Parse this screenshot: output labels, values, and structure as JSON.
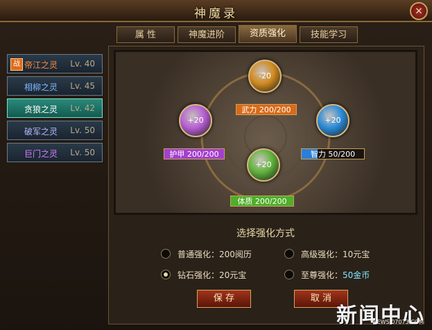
{
  "window": {
    "title": "神魔录",
    "close_glyph": "×"
  },
  "tabs": [
    {
      "label": "属  性"
    },
    {
      "label": "神魔进阶"
    },
    {
      "label": "资质强化"
    },
    {
      "label": "技能学习"
    }
  ],
  "sidebar": {
    "items": [
      {
        "name": "帝江之灵",
        "lv": "Lv. 40",
        "color": "#ff8a3d",
        "badge": "战"
      },
      {
        "name": "相柳之灵",
        "lv": "Lv. 45",
        "color": "#7fb8ff"
      },
      {
        "name": "贪狼之灵",
        "lv": "Lv. 42",
        "color": "#ffffff"
      },
      {
        "name": "破军之灵",
        "lv": "Lv. 50",
        "color": "#b9b6ff"
      },
      {
        "name": "巨门之灵",
        "lv": "Lv. 50",
        "color": "#d77cff"
      }
    ]
  },
  "stage": {
    "orbs": [
      {
        "id": "wuli",
        "value": "-20",
        "color": "#d18a1f",
        "stat": "武力 200/200",
        "fill_color": "#d96a18",
        "fraction": 1.0
      },
      {
        "id": "hujia",
        "value": "+20",
        "color": "#b75ed3",
        "stat": "护甲 200/200",
        "fill_color": "#a43fd0",
        "fraction": 1.0
      },
      {
        "id": "zhili",
        "value": "+20",
        "color": "#2a8ad8",
        "stat": "智力  50/200",
        "fill_color": "#2a7fd8",
        "fraction": 0.25
      },
      {
        "id": "tizhi",
        "value": "+20",
        "color": "#5fb23a",
        "stat": "体质 200/200",
        "fill_color": "#4fae2a",
        "fraction": 1.0
      }
    ]
  },
  "options": {
    "title": "选择强化方式",
    "items": [
      {
        "label": "普通强化：",
        "value": "200阅历",
        "checked": false,
        "accent": false
      },
      {
        "label": "高级强化：",
        "value": "10元宝",
        "checked": false,
        "accent": false
      },
      {
        "label": "钻石强化：",
        "value": "20元宝",
        "checked": true,
        "accent": false
      },
      {
        "label": "至尊强化：",
        "value": "50金币",
        "checked": false,
        "accent": true
      }
    ]
  },
  "buttons": {
    "save": "保  存",
    "cancel": "取  消"
  },
  "watermark": {
    "text": "新闻中心",
    "sub": "NEWS.07073.COM"
  }
}
